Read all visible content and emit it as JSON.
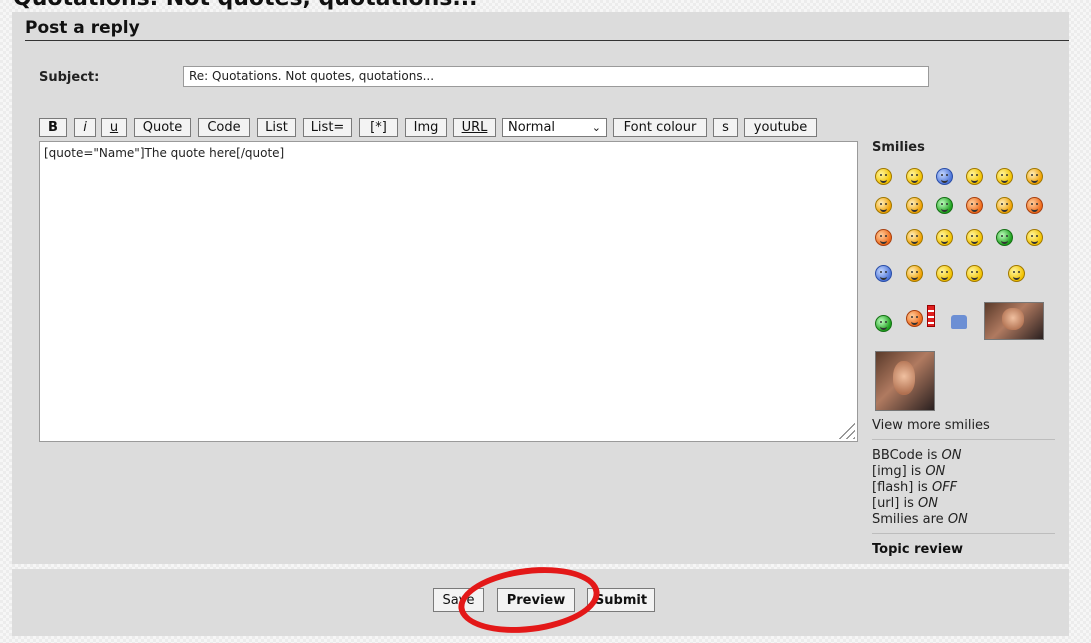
{
  "topic_title": "Quotations. Not quotes, quotations...",
  "heading": "Post a reply",
  "subject": {
    "label": "Subject:",
    "value": "Re: Quotations. Not quotes, quotations..."
  },
  "toolbar": {
    "bold": "B",
    "italic": "i",
    "underline": "u",
    "quote": "Quote",
    "code": "Code",
    "list": "List",
    "list_eq": "List=",
    "list_item": "[*]",
    "img": "Img",
    "url": "URL",
    "font_size": "Normal",
    "font_colour": "Font colour",
    "strike": "s",
    "youtube": "youtube"
  },
  "editor_text": "[quote=\"Name\"]The quote here[/quote]",
  "smilies": {
    "heading": "Smilies",
    "view_more": "View more smilies",
    "icons": [
      "smile-icon",
      "happy-icon",
      "sad-icon",
      "confused-icon",
      "question-icon",
      "cool-icon",
      "laugh-icon",
      "mad-icon",
      "green-icon",
      "angry-icon",
      "eek-icon",
      "devil-icon",
      "evil-icon",
      "rolleyes-icon",
      "wink-icon",
      "neutral-icon",
      "grin-icon",
      "surprised-icon",
      "blue-frown-icon",
      "love-icon",
      "dizzy-icon",
      "whistle-icon",
      "gun-icon",
      "sick-icon",
      "e-bar-icon",
      "thumbs-up-icon",
      "photo-smiley-icon",
      "photo-smiley-icon"
    ]
  },
  "options": {
    "bbcode_label": "BBCode is ",
    "bbcode_value": "ON",
    "img_label": "[img] is ",
    "img_value": "ON",
    "flash_label": "[flash] is ",
    "flash_value": "OFF",
    "url_label": "[url] is ",
    "url_value": "ON",
    "smilies_label": "Smilies are ",
    "smilies_value": "ON"
  },
  "topic_review": "Topic review",
  "buttons": {
    "save": "Save",
    "preview": "Preview",
    "submit": "Submit"
  },
  "annotation_color": "#e31818"
}
